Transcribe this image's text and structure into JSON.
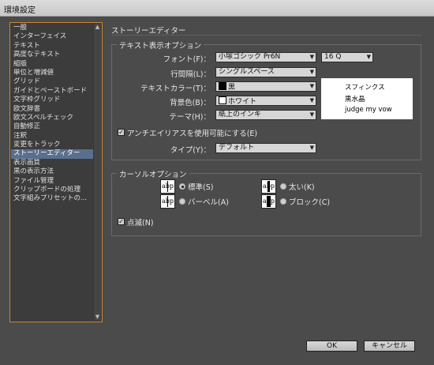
{
  "window": {
    "title": "環境設定"
  },
  "sidebar": {
    "items": [
      "一般",
      "インターフェイス",
      "テキスト",
      "高度なテキスト",
      "組版",
      "単位と増減値",
      "グリッド",
      "ガイドとペーストボード",
      "文字枠グリッド",
      "欧文辞書",
      "欧文スペルチェック",
      "自動修正",
      "注釈",
      "変更をトラック",
      "ストーリーエディター",
      "表示画質",
      "黒の表示方法",
      "ファイル管理",
      "クリップボードの処理",
      "文字組みプリセットの..."
    ],
    "selected_index": 14
  },
  "section": {
    "title": "ストーリーエディター"
  },
  "text_display": {
    "label": "テキスト表示オプション",
    "font_label": "フォント(F)：",
    "font_value": "小塚ゴシック Pr6N",
    "size_value": "16 Q",
    "leading_label": "行間隔(L)：",
    "leading_value": "シングルスペース",
    "text_color_label": "テキストカラー(T)：",
    "text_color_value": "黒",
    "text_color_hex": "#000000",
    "background_label": "背景色(B)：",
    "background_value": "ホワイト",
    "background_hex": "#ffffff",
    "theme_label": "テーマ(H)：",
    "theme_value": "紙上のインキ",
    "preview_lines": [
      "スフィンクス",
      "黒水晶",
      "judge my vow"
    ],
    "antialias_label": "アンチエイリアスを使用可能にする(E)",
    "antialias_checked": true,
    "type_label": "タイプ(Y)：",
    "type_value": "デフォルト"
  },
  "cursor_options": {
    "label": "カーソルオプション",
    "options": [
      {
        "label": "標準(S)",
        "selected": true,
        "icon": "cursor-standard-icon"
      },
      {
        "label": "太い(K)",
        "selected": false,
        "icon": "cursor-thick-icon"
      },
      {
        "label": "バーベル(A)",
        "selected": false,
        "icon": "cursor-barbell-icon"
      },
      {
        "label": "ブロック(C)",
        "selected": false,
        "icon": "cursor-block-icon"
      }
    ],
    "blink_label": "点滅(N)",
    "blink_checked": true
  },
  "buttons": {
    "ok": "OK",
    "cancel": "キャンセル"
  },
  "colors": {
    "background": "#4b4b4b",
    "selection": "#5a6f8e",
    "sidebar_border": "#c8852e"
  }
}
